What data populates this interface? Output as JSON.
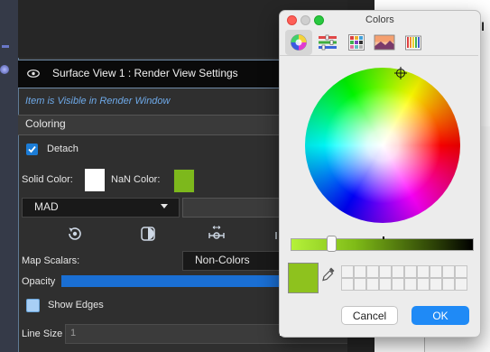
{
  "panel": {
    "title": "Surface View 1 : Render View Settings",
    "visible_note": "Item is Visible in Render Window",
    "coloring_section": "Coloring",
    "detach_label": "Detach",
    "detach_checked": true,
    "solid_color_label": "Solid Color:",
    "solid_color": "#ffffff",
    "nan_color_label": "NaN Color:",
    "nan_color": "#7db81c",
    "coloring_mode": "MAD",
    "map_scalars_label": "Map Scalars:",
    "map_scalars_value": "Non-Colors",
    "opacity_label": "Opacity",
    "opacity_fraction": 1.0,
    "show_edges_label": "Show Edges",
    "show_edges_checked": false,
    "line_size_label": "Line Size",
    "line_size_value": "1",
    "toolbar_icons": [
      "reset-range-icon",
      "invert-colormap-icon",
      "rescale-range-icon"
    ]
  },
  "colors_window": {
    "title": "Colors",
    "tabs": [
      "color-wheel-icon",
      "color-sliders-icon",
      "color-palettes-icon",
      "image-palettes-icon",
      "pencils-icon"
    ],
    "active_tab": "color-wheel-icon",
    "brightness_fraction": 0.22,
    "current_color": "#8ec21e",
    "cancel_label": "Cancel",
    "ok_label": "OK"
  },
  "background": {
    "partial_text": "el"
  }
}
